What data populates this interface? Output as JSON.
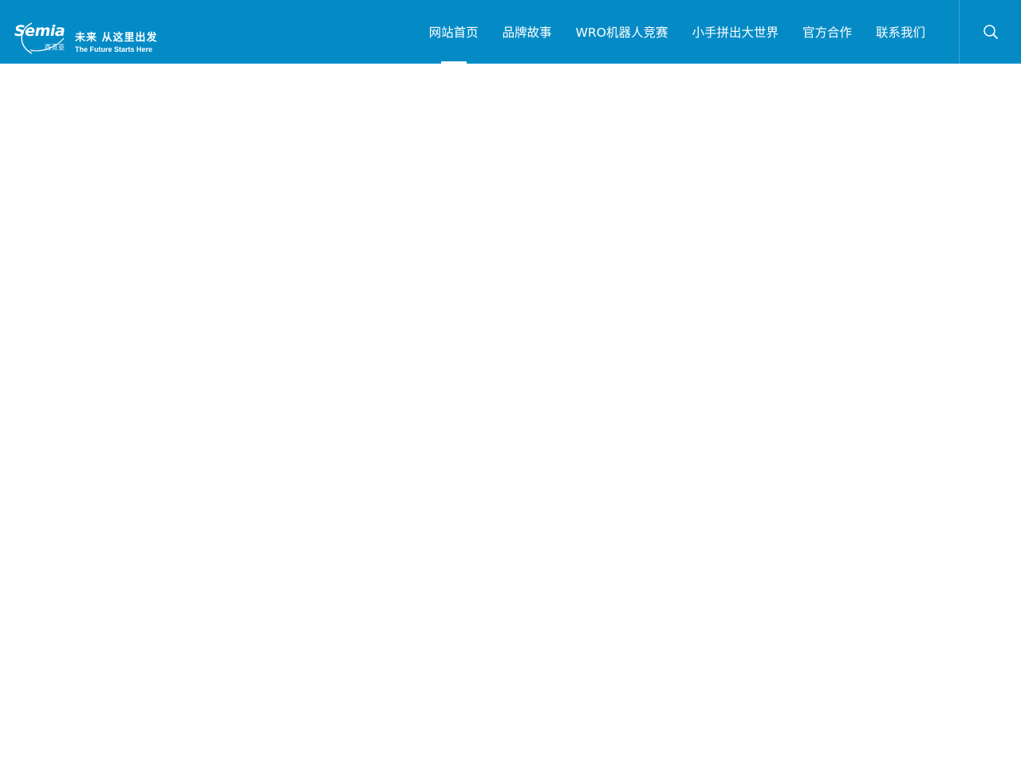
{
  "brand": {
    "wordmark": "Semia",
    "cn_name": "西觅亚",
    "slogan_cn": "未来 从这里出发",
    "slogan_en": "The Future Starts Here"
  },
  "nav": {
    "items": [
      {
        "label": "网站首页",
        "active": true
      },
      {
        "label": "品牌故事",
        "active": false
      },
      {
        "label": "WRO机器人竞赛",
        "active": false
      },
      {
        "label": "小手拼出大世界",
        "active": false
      },
      {
        "label": "官方合作",
        "active": false
      },
      {
        "label": "联系我们",
        "active": false
      }
    ]
  },
  "search": {
    "icon": "search-icon"
  },
  "colors": {
    "header_bg": "#048bc6",
    "text": "#ffffff",
    "page_bg": "#ffffff"
  }
}
